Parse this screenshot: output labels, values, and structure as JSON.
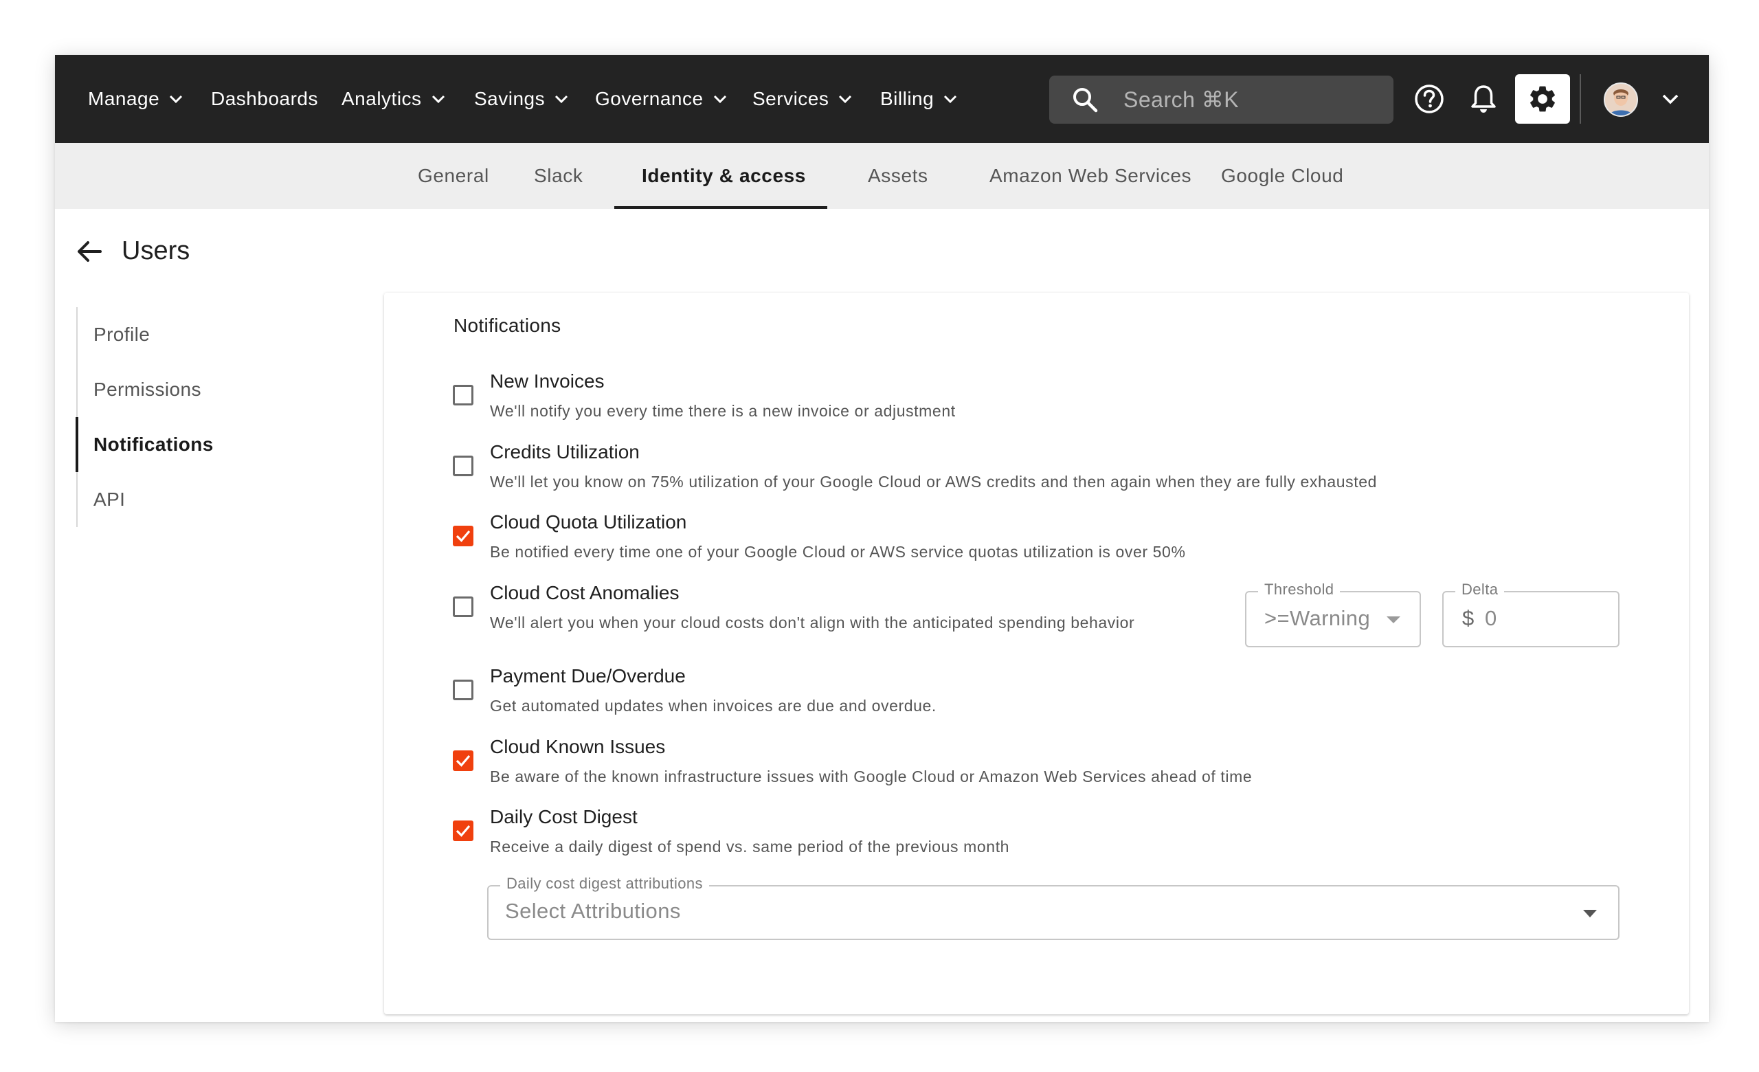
{
  "topnav": {
    "menu": [
      {
        "label": "Manage",
        "dropdown": true
      },
      {
        "label": "Dashboards",
        "dropdown": false
      },
      {
        "label": "Analytics",
        "dropdown": true
      },
      {
        "label": "Savings",
        "dropdown": true
      },
      {
        "label": "Governance",
        "dropdown": true
      },
      {
        "label": "Services",
        "dropdown": true
      },
      {
        "label": "Billing",
        "dropdown": true
      }
    ],
    "search_placeholder": "Search ⌘K",
    "icons": [
      "help-icon",
      "bell-icon",
      "gear-icon",
      "avatar",
      "chevron-down-icon"
    ]
  },
  "tabs": [
    {
      "label": "General",
      "active": false
    },
    {
      "label": "Slack",
      "active": false
    },
    {
      "label": "Identity & access",
      "active": true
    },
    {
      "label": "Assets",
      "active": false
    },
    {
      "label": "Amazon Web Services",
      "active": false
    },
    {
      "label": "Google Cloud",
      "active": false
    }
  ],
  "page": {
    "title": "Users"
  },
  "sidebar": {
    "items": [
      {
        "label": "Profile",
        "active": false
      },
      {
        "label": "Permissions",
        "active": false
      },
      {
        "label": "Notifications",
        "active": true
      },
      {
        "label": "API",
        "active": false
      }
    ]
  },
  "notifications": {
    "title": "Notifications",
    "options": [
      {
        "title": "New Invoices",
        "desc": "We'll notify you every time there is a new invoice or adjustment",
        "checked": false
      },
      {
        "title": "Credits Utilization",
        "desc": "We'll let you know on 75% utilization of your Google Cloud or AWS credits and then again when they are fully exhausted",
        "checked": false
      },
      {
        "title": "Cloud Quota Utilization",
        "desc": "Be notified every time one of your Google Cloud or AWS service quotas utilization is over 50%",
        "checked": true
      },
      {
        "title": "Cloud Cost Anomalies",
        "desc": "We'll alert you when your cloud costs don't align with the anticipated spending behavior",
        "checked": false
      },
      {
        "title": "Payment Due/Overdue",
        "desc": "Get automated updates when invoices are due and overdue.",
        "checked": false
      },
      {
        "title": "Cloud Known Issues",
        "desc": "Be aware of the known infrastructure issues with Google Cloud or Amazon Web Services ahead of time",
        "checked": true
      },
      {
        "title": "Daily Cost Digest",
        "desc": "Receive a daily digest of spend vs. same period of the previous month",
        "checked": true
      }
    ],
    "threshold": {
      "label": "Threshold",
      "value": ">=Warning"
    },
    "delta": {
      "label": "Delta",
      "prefix": "$",
      "value": "0"
    },
    "attributions": {
      "label": "Daily cost digest attributions",
      "placeholder": "Select Attributions"
    }
  },
  "colors": {
    "nav_bg": "#232323",
    "accent": "#f0400e",
    "subnav_bg": "#eeeeee"
  }
}
